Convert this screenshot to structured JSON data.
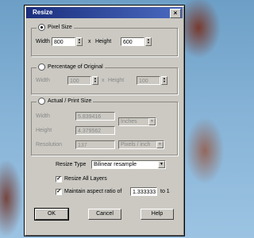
{
  "dialog": {
    "title": "Resize",
    "close_glyph": "×"
  },
  "pixel_size": {
    "label": "Pixel Size",
    "width_label": "Width",
    "width_value": "800",
    "x_label": "x",
    "height_label": "Height",
    "height_value": "600"
  },
  "percentage": {
    "label": "Percentage of Original",
    "width_label": "Width",
    "width_value": "100",
    "x_label": "x",
    "height_label": "Height",
    "height_value": "100"
  },
  "print_size": {
    "label": "Actual / Print Size",
    "width_label": "Width",
    "width_value": "5.839416",
    "height_label": "Height",
    "height_value": "4.379562",
    "units": "Inches",
    "resolution_label": "Resolution",
    "resolution_value": "137",
    "resolution_units": "Pixels / inch"
  },
  "resize_type": {
    "label": "Resize Type",
    "value": "Bilinear resample"
  },
  "resize_all_layers": {
    "label": "Resize All Layers",
    "checked": true,
    "check_glyph": "✓"
  },
  "aspect": {
    "label": "Maintain aspect ratio of",
    "value": "1.333333",
    "suffix": "to 1",
    "checked": true,
    "check_glyph": "✓"
  },
  "buttons": {
    "ok": "OK",
    "cancel": "Cancel",
    "help": "Help"
  },
  "glyphs": {
    "up": "▲",
    "down": "▼"
  }
}
